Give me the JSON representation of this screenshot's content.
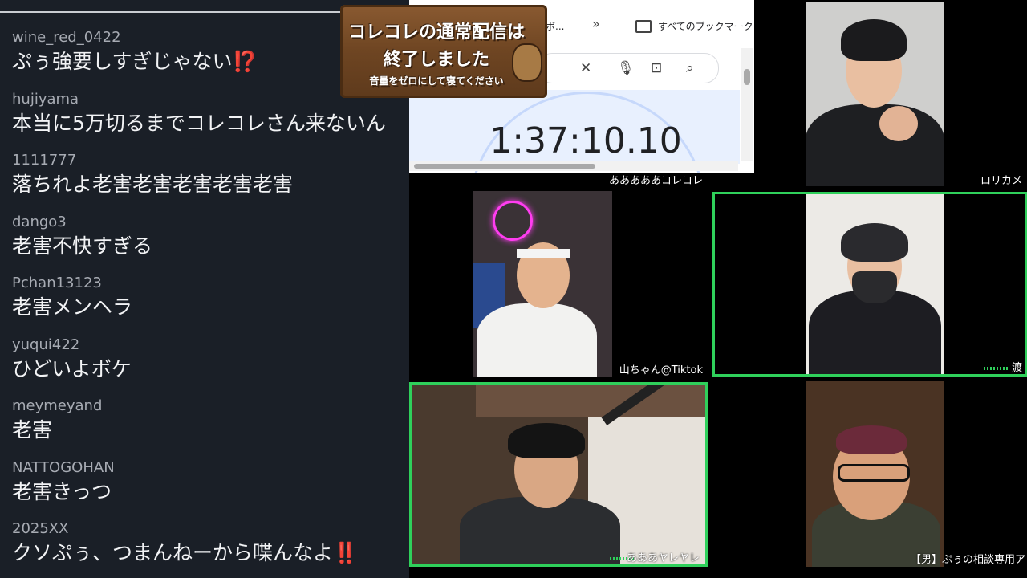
{
  "chat": {
    "messages": [
      {
        "user": "wine_red_0422",
        "text": "ぷぅ強要しすぎじゃない",
        "emoji": "⁉️"
      },
      {
        "user": "hujiyama",
        "text": "本当に5万切るまでコレコレさん来ないん",
        "emoji": ""
      },
      {
        "user": "1111777",
        "text": "落ちれよ老害老害老害老害老害",
        "emoji": ""
      },
      {
        "user": "dango3",
        "text": "老害不快すぎる",
        "emoji": ""
      },
      {
        "user": "Pchan13123",
        "text": "老害メンヘラ",
        "emoji": ""
      },
      {
        "user": "yuqui422",
        "text": "ひどいよボケ",
        "emoji": ""
      },
      {
        "user": "meymeyand",
        "text": "老害",
        "emoji": ""
      },
      {
        "user": "NATTOGOHAN",
        "text": "老害きっつ",
        "emoji": ""
      },
      {
        "user": "2025XX",
        "text": "クソぷぅ、つまんねーから喋んなよ",
        "emoji": "‼️"
      }
    ]
  },
  "browser": {
    "bookmark_partial": "ボ...",
    "bookmarks_label": "すべてのブックマーク",
    "timer": "1:37:10.10"
  },
  "sign": {
    "line1": "コレコレの通常配信は",
    "line2": "終了しました",
    "line3": "音量をゼロにして寝てください"
  },
  "participants": {
    "host_label": "あああああコレコレ",
    "top_right": "ロリカメ",
    "middle_left": "山ちゃん@Tiktok",
    "middle_right": "渡",
    "bottom_left": "あああヤレヤレ",
    "bottom_right": "【男】ぷぅの相談専用ア"
  },
  "colors": {
    "active_border": "#2fd05b",
    "chat_bg": "#1a1f27"
  }
}
